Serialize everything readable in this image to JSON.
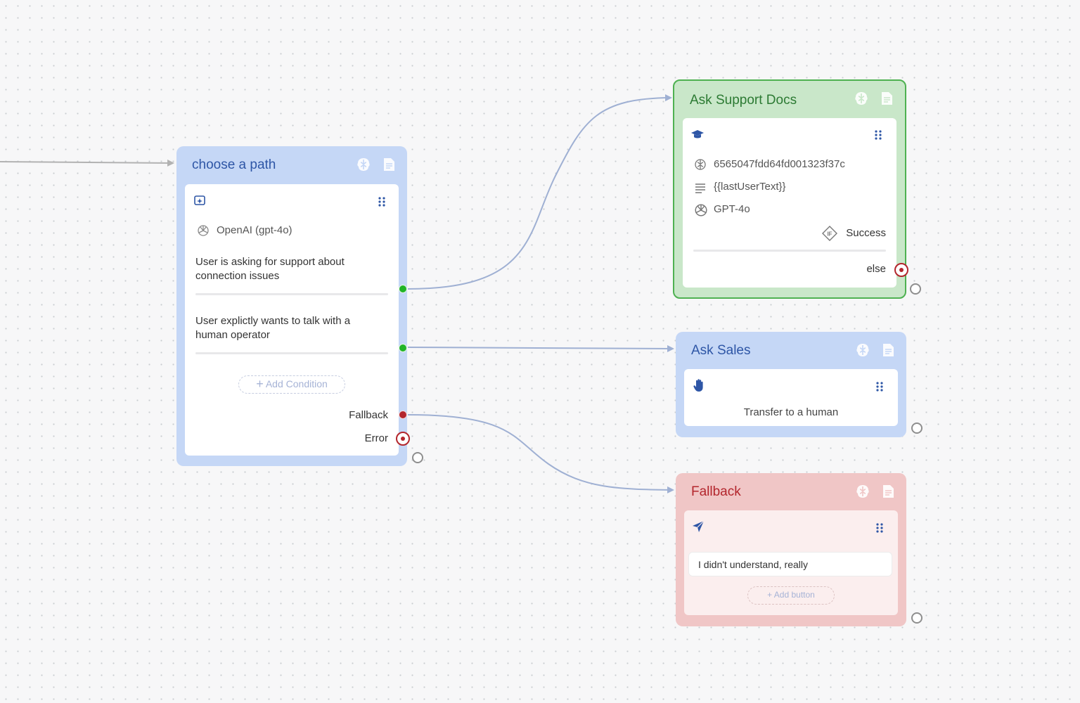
{
  "colors": {
    "blue_node": "#c5d7f6",
    "green_node": "#c9e7c9",
    "green_border": "#4eb151",
    "red_node": "#f0c6c6",
    "edge": "#9fb0d3"
  },
  "choose_node": {
    "title": "choose a path",
    "model": "OpenAI (gpt-4o)",
    "conditions": [
      "User is asking for support about connection issues",
      "User explictly wants to talk with a human operator"
    ],
    "add_condition_label": "Add Condition",
    "fallback_label": "Fallback",
    "error_label": "Error",
    "icons": [
      "brain-icon",
      "notes-icon",
      "ai-sparkle-icon",
      "drag-handle-icon",
      "openai-icon"
    ]
  },
  "support_node": {
    "title": "Ask Support Docs",
    "kb_id": "6565047fdd64fd001323f37c",
    "query": "{{lastUserText}}",
    "model": "GPT-4o",
    "success_label": "Success",
    "else_label": "else",
    "icons": [
      "brain-icon",
      "notes-icon",
      "graduation-cap-icon",
      "drag-handle-icon",
      "knowledge-icon",
      "text-lines-icon",
      "openai-icon",
      "if-condition-icon"
    ]
  },
  "sales_node": {
    "title": "Ask Sales",
    "text": "Transfer to a human",
    "icons": [
      "brain-icon",
      "notes-icon",
      "hand-icon",
      "drag-handle-icon"
    ]
  },
  "fallback_node": {
    "title": "Fallback",
    "message": "I didn't understand, really",
    "add_button_label": "+ Add button",
    "icons": [
      "brain-icon",
      "notes-icon",
      "send-icon",
      "drag-handle-icon"
    ]
  }
}
